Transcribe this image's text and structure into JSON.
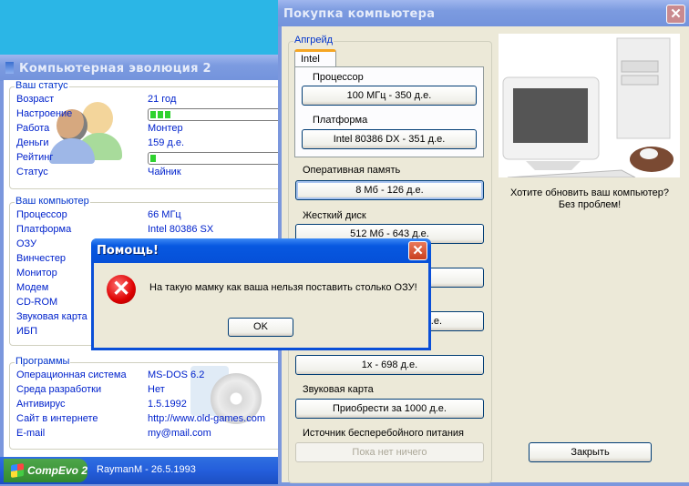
{
  "main_window": {
    "title": "Компьютерная эволюция 2",
    "status_group": {
      "title": "Ваш статус",
      "rows": [
        {
          "label": "Возраст",
          "value": "21 год"
        },
        {
          "label": "Настроение",
          "progress": 0.15
        },
        {
          "label": "Работа",
          "value": "Монтер"
        },
        {
          "label": "Деньги",
          "value": "159 д.е."
        },
        {
          "label": "Рейтинг",
          "progress": 0.05
        },
        {
          "label": "Статус",
          "value": "Чайник"
        }
      ]
    },
    "computer_group": {
      "title": "Ваш компьютер",
      "rows": [
        {
          "label": "Процессор",
          "value": "66 МГц"
        },
        {
          "label": "Платформа",
          "value": "Intel 80386 SX"
        },
        {
          "label": "ОЗУ"
        },
        {
          "label": "Винчестер"
        },
        {
          "label": "Монитор"
        },
        {
          "label": "Модем"
        },
        {
          "label": "CD-ROM"
        },
        {
          "label": "Звуковая карта"
        },
        {
          "label": "ИБП"
        }
      ]
    },
    "programs_group": {
      "title": "Программы",
      "rows": [
        {
          "label": "Операционная система",
          "value": "MS-DOS 6.2"
        },
        {
          "label": "Среда разработки",
          "value": "Нет"
        },
        {
          "label": "Антивирус",
          "value": "1.5.1992"
        },
        {
          "label": "Сайт в интернете",
          "value": "http://www.old-games.com"
        },
        {
          "label": "E-mail",
          "value": "my@mail.com"
        }
      ]
    },
    "start_button": "CompEvo 2",
    "status_text": "RaymanM - 26.5.1993"
  },
  "buy_window": {
    "title": "Покупка компьютера",
    "upgrade_group": "Апгрейд",
    "tab": "Intel",
    "cpu_label": "Процессор",
    "cpu_button": "100 МГц - 350 д.е.",
    "platform_label": "Платформа",
    "platform_button": "Intel 80386 DX - 351 д.е.",
    "ram_label": "Оперативная память",
    "ram_button": "8 Мб - 126 д.е.",
    "hdd_label": "Жесткий диск",
    "hdd_button": "512 Мб - 643 д.е.",
    "hidden_button_partial": "8 д.е.",
    "cdrom_button": "1x - 698 д.е.",
    "sound_label": "Звуковая карта",
    "sound_button": "Приобрести за 1000 д.е.",
    "ups_label": "Источник бесперебойного питания",
    "ups_button": "Пока нет ничего",
    "promo_line1": "Хотите обновить ваш компьютер?",
    "promo_line2": "Без проблем!",
    "close_button": "Закрыть"
  },
  "dialog": {
    "title": "Помощь!",
    "message": "На такую мамку как ваша нельзя поставить столько ОЗУ!",
    "ok_button": "OK"
  }
}
